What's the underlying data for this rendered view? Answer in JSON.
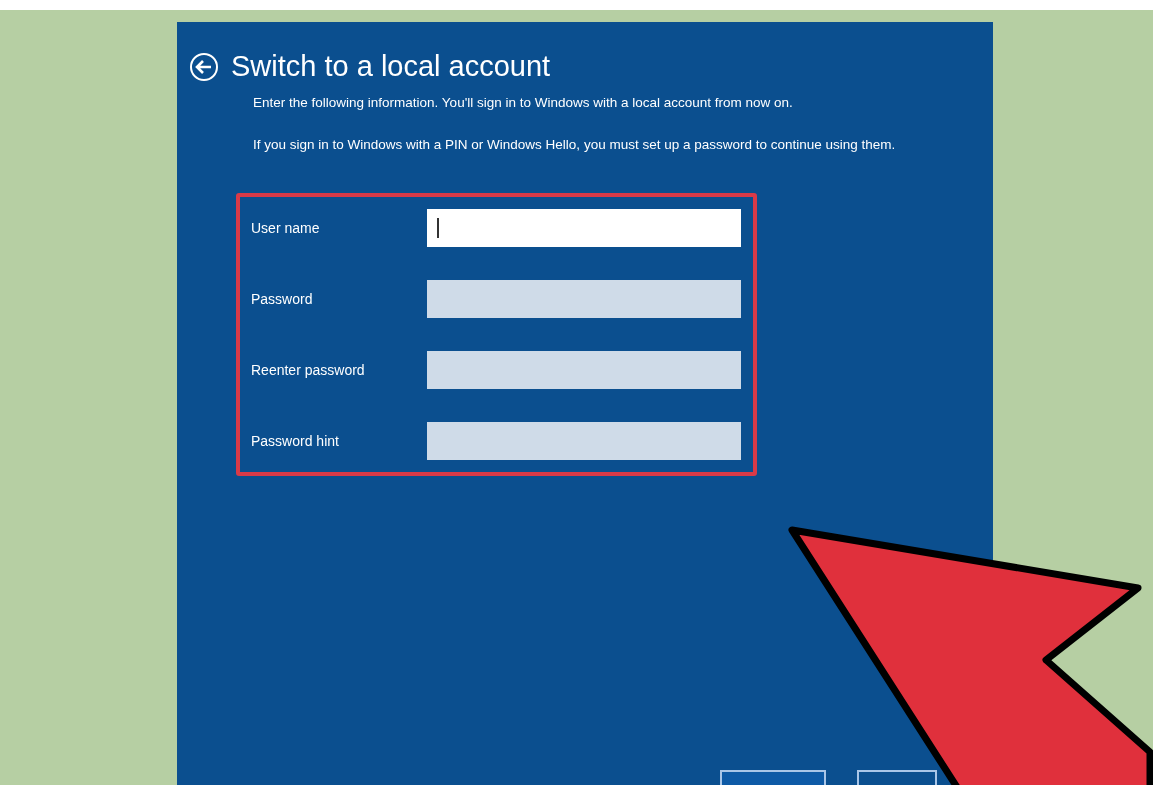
{
  "dialog": {
    "title": "Switch to a local account",
    "paragraphs": [
      "Enter the following information. You'll sign in to Windows with a local account from now on.",
      "If you sign in to Windows with a PIN or Windows Hello, you must set up a password to continue using them."
    ],
    "fields": [
      {
        "label": "User name",
        "focused": true
      },
      {
        "label": "Password",
        "focused": false
      },
      {
        "label": "Reenter password",
        "focused": false
      },
      {
        "label": "Password hint",
        "focused": false
      }
    ],
    "buttons": [
      {
        "kind": "primary"
      },
      {
        "kind": "secondary"
      }
    ]
  }
}
